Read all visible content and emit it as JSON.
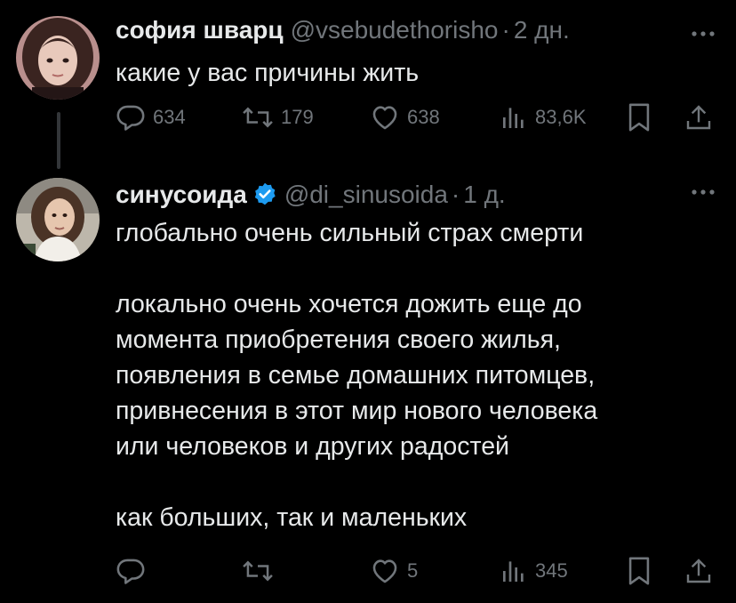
{
  "tweets": [
    {
      "display_name": "софия шварц",
      "handle": "@vsebudethorisho",
      "separator": "·",
      "time": "2 дн.",
      "text": "какие у вас причины жить",
      "stats": {
        "replies": "634",
        "reposts": "179",
        "likes": "638",
        "views": "83,6K"
      }
    },
    {
      "display_name": "синусоида",
      "handle": "@di_sinusoida",
      "separator": "·",
      "time": "1 д.",
      "text": "глобально очень сильный страх смерти\n\nлокально очень хочется дожить еще до\nмомента приобретения своего жилья,\nпоявления в семье домашних питомцев,\nпривнесения в этот мир нового человека\nили человеков и других радостей\n\nкак больших, так и маленьких",
      "stats": {
        "replies": "",
        "reposts": "",
        "likes": "5",
        "views": "345"
      }
    }
  ],
  "icons": [
    "reply-icon",
    "repost-icon",
    "like-icon",
    "views-icon",
    "bookmark-icon",
    "share-icon",
    "more-icon",
    "verified-icon"
  ],
  "colors": {
    "background": "#000000",
    "text": "#e7e9ea",
    "muted": "#71767b",
    "verified": "#1d9bf0"
  }
}
